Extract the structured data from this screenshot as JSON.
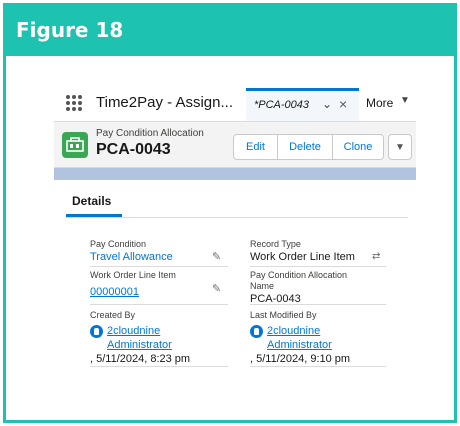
{
  "figure": {
    "title": "Figure 18"
  },
  "appbar": {
    "app_name": "Time2Pay - Assign...",
    "tab_label": "*PCA-0043",
    "more_label": "More"
  },
  "record": {
    "object_type": "Pay Condition Allocation",
    "name": "PCA-0043",
    "buttons": {
      "edit": "Edit",
      "delete": "Delete",
      "clone": "Clone"
    }
  },
  "details": {
    "tab_label": "Details",
    "fields": {
      "pay_condition": {
        "label": "Pay Condition",
        "value": "Travel Allowance"
      },
      "record_type": {
        "label": "Record Type",
        "value": "Work Order Line Item"
      },
      "work_order_line_item": {
        "label": "Work Order Line Item",
        "value": "00000001"
      },
      "pca_name": {
        "label_line1": "Pay Condition Allocation",
        "label_line2": "Name",
        "value": "PCA-0043"
      },
      "created_by": {
        "label": "Created By",
        "user_line1": "2cloudnine",
        "user_line2": "Administrator",
        "date": ", 5/11/2024, 8:23 pm"
      },
      "last_modified_by": {
        "label": "Last Modified By",
        "user_line1": "2cloudnine",
        "user_line2": "Administrator",
        "date": ", 5/11/2024, 9:10 pm"
      }
    }
  },
  "colors": {
    "accent": "#1ec2b0",
    "brand_blue": "#0176d3",
    "record_icon": "#3ba755"
  }
}
